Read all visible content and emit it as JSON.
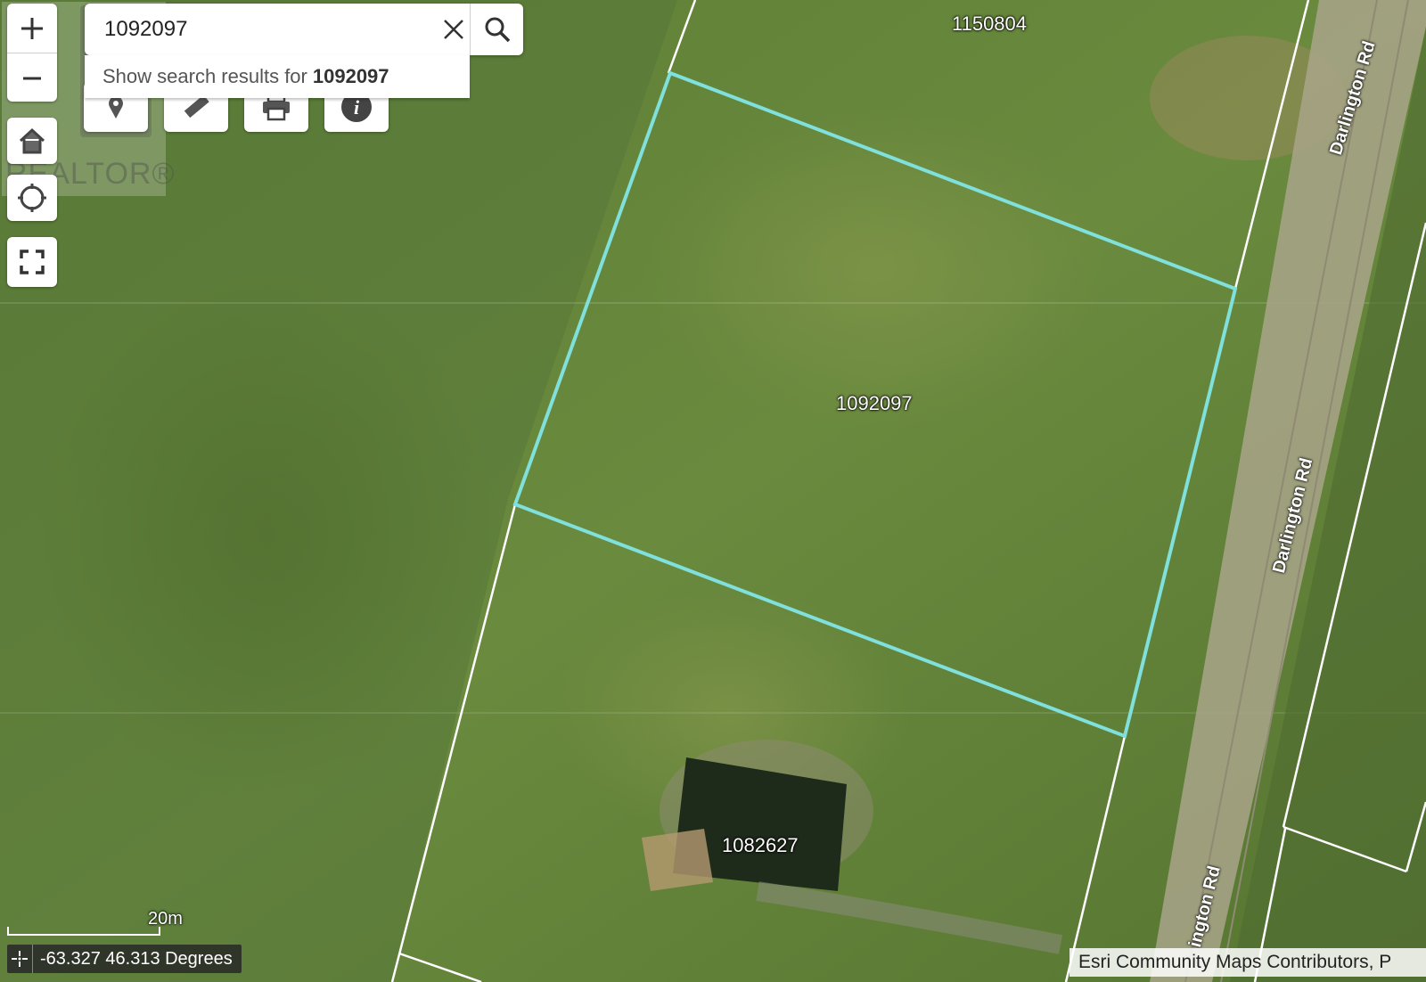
{
  "search": {
    "value": "1092097",
    "suggestion_prefix": "Show search results for",
    "suggestion_query": "1092097"
  },
  "watermark": {
    "text": "REALTOR®"
  },
  "parcels": {
    "highlighted": "1092097",
    "north": "1150804",
    "south": "1082627"
  },
  "roads": [
    "Darlington Rd",
    "Darlington Rd",
    "ington Rd"
  ],
  "scale": {
    "label": "20m"
  },
  "coordinates": {
    "text": "-63.327 46.313 Degrees"
  },
  "attribution": {
    "text": "Esri Community Maps Contributors, P"
  },
  "colors": {
    "highlight_outline": "#7fe0dc",
    "parcel_line": "#ffffff",
    "field": "#6a8a3c"
  },
  "icons": {
    "zoom_in": "plus-icon",
    "zoom_out": "minus-icon",
    "home": "home-icon",
    "locate": "locate-icon",
    "fullscreen": "fullscreen-icon",
    "identify": "location-pin-icon",
    "measure": "ruler-icon",
    "print": "printer-icon",
    "info": "info-icon",
    "clear": "close-icon",
    "search": "search-icon"
  }
}
